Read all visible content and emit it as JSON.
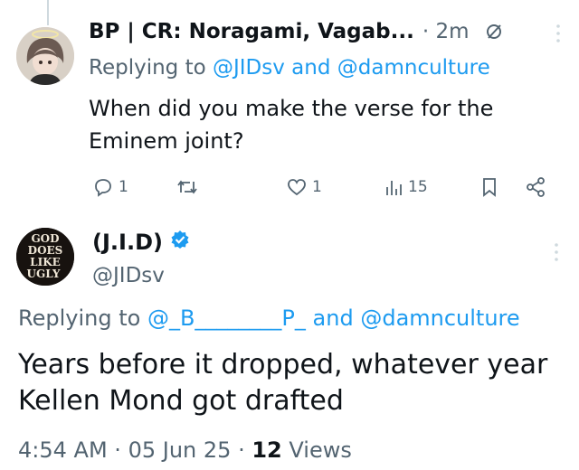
{
  "tweet1": {
    "display_name": "BP | CR: Noragami, Vagab...",
    "time": "2m",
    "replying_prefix": "Replying to",
    "mention_1": "@JIDsv",
    "and_word": "and",
    "mention_2": "@damnculture",
    "text": "When did you make the verse for the Eminem joint?",
    "actions": {
      "replies": "1",
      "reposts": "",
      "likes": "1",
      "views": "15"
    },
    "icons": [
      "mute-icon",
      "more-icon",
      "reply-icon",
      "repost-icon",
      "like-icon",
      "views-icon",
      "bookmark-icon",
      "share-icon"
    ]
  },
  "tweet2": {
    "display_name": "(J.I.D)",
    "handle": "@JIDsv",
    "avatar_text": [
      "GOD",
      "DOES",
      "LIKE",
      "UGLY"
    ],
    "replying_prefix": "Replying to",
    "mention_1": "@_B________P_",
    "and_word": "and",
    "mention_2": "@damnculture",
    "text": "Years before it dropped, whatever year Kellen Mond got drafted",
    "time": "4:54 AM",
    "date": "05 Jun 25",
    "views_count": "12",
    "views_label": "Views",
    "separator": "·",
    "icons": [
      "verified-icon",
      "more-icon"
    ]
  },
  "colors": {
    "link": "#1d9bf0",
    "secondary_text": "#536471",
    "primary_text": "#0f1419",
    "thread_line": "#cfd9de"
  }
}
